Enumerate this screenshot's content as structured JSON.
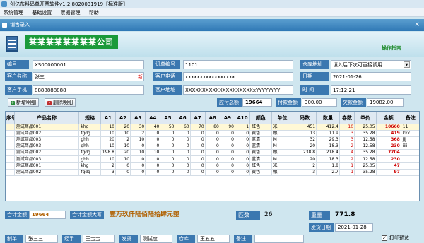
{
  "window": {
    "title": "创亿布料码单开票软件v1.2.8020031919【标准版】"
  },
  "menu": [
    "系统管理",
    "基础设置",
    "票据管理",
    "帮助"
  ],
  "child": {
    "title": "销售录入",
    "close": "×"
  },
  "banner": {
    "company": "某某某某某某某某公司",
    "guide": "操作指南"
  },
  "form": {
    "no_label": "编号",
    "no_value": "XS00000001",
    "order_label": "订单编号",
    "order_value": "1101",
    "warehouse_label": "仓库地址",
    "warehouse_value": "填入后下次可直接调用",
    "cust_name_label": "客户名称",
    "cust_name_value": "张三",
    "new_mark": "新",
    "cust_phone_label": "客户电话",
    "cust_phone_value": "xxxxxxxxxxxxxxxxx",
    "date_label": "日期",
    "date_value": "2021-01-26",
    "cust_mobile_label": "客户手机",
    "cust_mobile_value": "8888888888",
    "cust_addr_label": "客户地址",
    "cust_addr_value": "XXXXXXXXXXXXXXXXXXXXxYYYYYYYY",
    "time_label": "时 间",
    "time_value": "17:12:21"
  },
  "toolbar": {
    "add_label": "新增明细",
    "del_label": "删除明细",
    "payable_label": "应付总额",
    "payable_value": "19664",
    "paid_label": "付款金额",
    "paid_value": "300.00",
    "owed_label": "欠款金额",
    "owed_value": "19082.00"
  },
  "table": {
    "headers": [
      "序号",
      "产品名称",
      "规格",
      "A1",
      "A2",
      "A3",
      "A4",
      "A5",
      "A6",
      "A7",
      "A8",
      "A9",
      "A10",
      "颜色",
      "单位",
      "码数",
      "数量",
      "卷数",
      "单价",
      "金额",
      "备注"
    ],
    "rows": [
      [
        "",
        "测试商品001",
        "khg",
        "10",
        "20",
        "30",
        "40",
        "50",
        "60",
        "70",
        "80",
        "90",
        "1",
        "红色",
        "米",
        "451",
        "412.4",
        "10",
        "25.05",
        "10660",
        "11"
      ],
      [
        "",
        "测试商品002",
        "fgdg",
        "10",
        "10",
        "2",
        "0",
        "0",
        "0",
        "0",
        "0",
        "0",
        "0",
        "黄色",
        "根",
        "13",
        "11.9",
        "3",
        "35.28",
        "419",
        "kkk"
      ],
      [
        "",
        "测试商品003",
        "ghh",
        "20",
        "2",
        "10",
        "0",
        "0",
        "0",
        "0",
        "0",
        "0",
        "0",
        "蓝清",
        "M",
        "32",
        "29.3",
        "3",
        "12.58",
        "368",
        "jjj"
      ],
      [
        "",
        "测试商品003",
        "ghh",
        "10",
        "10",
        "0",
        "0",
        "0",
        "0",
        "0",
        "0",
        "0",
        "0",
        "蓝清",
        "M",
        "20",
        "18.3",
        "2",
        "12.58",
        "230",
        "iiii"
      ],
      [
        "",
        "测试商品002",
        "fgdg",
        "198.8",
        "20",
        "10",
        "10",
        "0",
        "0",
        "0",
        "0",
        "0",
        "0",
        "黄色",
        "根",
        "238.8",
        "218.4",
        "4",
        "35.28",
        "7704",
        ""
      ],
      [
        "",
        "测试商品003",
        "ghh",
        "10",
        "10",
        "0",
        "0",
        "0",
        "0",
        "0",
        "0",
        "0",
        "0",
        "蓝清",
        "M",
        "20",
        "18.3",
        "2",
        "12.58",
        "230",
        ""
      ],
      [
        "",
        "测试商品001",
        "khg",
        "2",
        "0",
        "0",
        "0",
        "0",
        "0",
        "0",
        "0",
        "0",
        "0",
        "红色",
        "米",
        "2",
        "1.8",
        "1",
        "25.05",
        "47",
        ""
      ],
      [
        "",
        "测试商品002",
        "fgdg",
        "3",
        "0",
        "0",
        "0",
        "0",
        "0",
        "0",
        "0",
        "0",
        "0",
        "黄色",
        "根",
        "3",
        "2.7",
        "1",
        "35.28",
        "97",
        ""
      ]
    ]
  },
  "summary": {
    "total_label": "合计金额",
    "total_value": "19664",
    "caps_label": "合计金额大写",
    "caps_value": "壹万玖仟陆佰陆拾肆元整",
    "count_label": "匹数",
    "count_value": "26",
    "weight_label": "重量",
    "weight_value": "771.8",
    "ship_label": "发货日期",
    "ship_value": "2021-01-28",
    "print_label": "打印预览",
    "bottom_row": [
      "制单",
      "张三三",
      "经手",
      "王宝宝",
      "发货",
      "测试度",
      "仓库",
      "王五五",
      "备注",
      ""
    ]
  }
}
